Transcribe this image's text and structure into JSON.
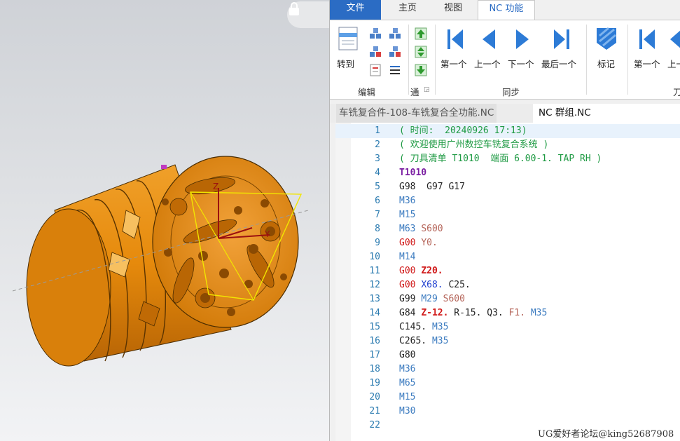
{
  "ribbon_tabs": [
    {
      "label": "文件"
    },
    {
      "label": "主页"
    },
    {
      "label": "视图"
    },
    {
      "label": "NC 功能"
    }
  ],
  "ribbon": {
    "goto_label": "转到",
    "edit_group": "编辑",
    "tong_group": "通",
    "nav_first": "第一个",
    "nav_prev": "上一个",
    "nav_next": "下一个",
    "nav_last": "最后一个",
    "sync_group": "同步",
    "mark_label": "标记",
    "first2": "第一个",
    "prev2": "上一",
    "group_cut": "刀"
  },
  "doc_tabs": [
    {
      "label": "车铣复合件-108-车铣复合全功能.NC"
    },
    {
      "label": "NC 群组.NC"
    }
  ],
  "code_lines": [
    {
      "n": "1",
      "tokens": [
        {
          "t": "( 时间:  20240926 17:13)",
          "c": "comment"
        }
      ]
    },
    {
      "n": "2",
      "tokens": [
        {
          "t": "( 欢迎使用广州数控车铣复合系统 )",
          "c": "comment"
        }
      ]
    },
    {
      "n": "3",
      "tokens": [
        {
          "t": "( 刀具清单 T1010  端面 6.00-1. TAP RH )",
          "c": "comment"
        }
      ]
    },
    {
      "n": "4",
      "tokens": [
        {
          "t": "T1010",
          "c": "tool"
        }
      ]
    },
    {
      "n": "5",
      "tokens": [
        {
          "t": "G98  G97 G17",
          "c": "g"
        }
      ]
    },
    {
      "n": "6",
      "tokens": [
        {
          "t": "M36",
          "c": "m"
        }
      ]
    },
    {
      "n": "7",
      "tokens": [
        {
          "t": "M15",
          "c": "m"
        }
      ]
    },
    {
      "n": "8",
      "tokens": [
        {
          "t": "M63 ",
          "c": "m"
        },
        {
          "t": "S600",
          "c": "s"
        }
      ]
    },
    {
      "n": "9",
      "tokens": [
        {
          "t": "G00 ",
          "c": "red"
        },
        {
          "t": "Y0.",
          "c": "s"
        }
      ]
    },
    {
      "n": "10",
      "tokens": [
        {
          "t": "M14",
          "c": "m"
        }
      ]
    },
    {
      "n": "11",
      "tokens": [
        {
          "t": "G00 ",
          "c": "red"
        },
        {
          "t": "Z20.",
          "c": "redb"
        }
      ]
    },
    {
      "n": "12",
      "tokens": [
        {
          "t": "G00 ",
          "c": "red"
        },
        {
          "t": "X68.",
          "c": "blue"
        },
        {
          "t": " C25.",
          "c": "plain"
        }
      ]
    },
    {
      "n": "13",
      "tokens": [
        {
          "t": "G99 ",
          "c": "g"
        },
        {
          "t": "M29 ",
          "c": "m"
        },
        {
          "t": "S600",
          "c": "s"
        }
      ]
    },
    {
      "n": "14",
      "tokens": [
        {
          "t": "G84 ",
          "c": "g"
        },
        {
          "t": "Z-12.",
          "c": "redb"
        },
        {
          "t": " R-15. Q3. ",
          "c": "plain"
        },
        {
          "t": "F1. ",
          "c": "s"
        },
        {
          "t": "M35",
          "c": "m"
        }
      ]
    },
    {
      "n": "15",
      "tokens": [
        {
          "t": "C145. ",
          "c": "plain"
        },
        {
          "t": "M35",
          "c": "m"
        }
      ]
    },
    {
      "n": "16",
      "tokens": [
        {
          "t": "C265. ",
          "c": "plain"
        },
        {
          "t": "M35",
          "c": "m"
        }
      ]
    },
    {
      "n": "17",
      "tokens": [
        {
          "t": "G80",
          "c": "g"
        }
      ]
    },
    {
      "n": "18",
      "tokens": [
        {
          "t": "M36",
          "c": "m"
        }
      ]
    },
    {
      "n": "19",
      "tokens": [
        {
          "t": "M65",
          "c": "m"
        }
      ]
    },
    {
      "n": "20",
      "tokens": [
        {
          "t": "M15",
          "c": "m"
        }
      ]
    },
    {
      "n": "21",
      "tokens": [
        {
          "t": "M30",
          "c": "m"
        }
      ]
    },
    {
      "n": "22",
      "tokens": []
    }
  ],
  "current_line": "1",
  "watermark": "UG爱好者论坛@king52687908",
  "colors": {
    "file_tab": "#2b6cc4",
    "part": "#e68a0c",
    "nav_arrow": "#2d7bd6",
    "comment": "#1e9a43",
    "tool": "#7b1fa2",
    "mcode": "#3a7abf",
    "red": "#d01818",
    "blue": "#1f3fd0",
    "scode": "#b5655a"
  },
  "icons": [
    "lock-icon",
    "goto-icon",
    "copy-icon",
    "paste-icon",
    "clipboard-icon",
    "list-icon",
    "up-arrow-icon",
    "up-down-arrow-icon",
    "down-arrow-icon",
    "first-icon",
    "prev-icon",
    "next-icon",
    "last-icon",
    "mark-icon"
  ]
}
